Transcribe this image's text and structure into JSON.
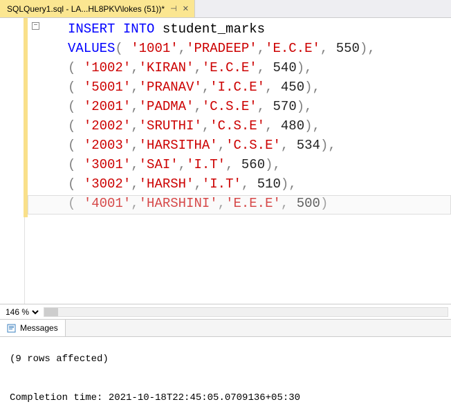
{
  "tab": {
    "title": "SQLQuery1.sql - LA...HL8PKV\\lokes (51))*",
    "pin": "⊣",
    "close": "✕"
  },
  "zoom": {
    "value": "146 %"
  },
  "collapse": "−",
  "results": {
    "tab_label": "Messages",
    "rows_affected": "(9 rows affected)",
    "completion": "Completion time: 2021-10-18T22:45:05.0709136+05:30"
  },
  "sql": {
    "kw_insert": "INSERT",
    "kw_into": "INTO",
    "table": "student_marks",
    "kw_values": "VALUES",
    "rows": [
      {
        "id": "'1001'",
        "name": "'PRADEEP'",
        "dept": "'E.C.E'",
        "marks": "550"
      },
      {
        "id": "'1002'",
        "name": "'KIRAN'",
        "dept": "'E.C.E'",
        "marks": "540"
      },
      {
        "id": "'5001'",
        "name": "'PRANAV'",
        "dept": "'I.C.E'",
        "marks": "450"
      },
      {
        "id": "'2001'",
        "name": "'PADMA'",
        "dept": "'C.S.E'",
        "marks": "570"
      },
      {
        "id": "'2002'",
        "name": "'SRUTHI'",
        "dept": "'C.S.E'",
        "marks": "480"
      },
      {
        "id": "'2003'",
        "name": "'HARSITHA'",
        "dept": "'C.S.E'",
        "marks": "534"
      },
      {
        "id": "'3001'",
        "name": "'SAI'",
        "dept": "'I.T'",
        "marks": "560"
      },
      {
        "id": "'3002'",
        "name": "'HARSH'",
        "dept": "'I.T'",
        "marks": "510"
      },
      {
        "id": "'4001'",
        "name": "'HARSHINI'",
        "dept": "'E.E.E'",
        "marks": "500"
      }
    ]
  }
}
